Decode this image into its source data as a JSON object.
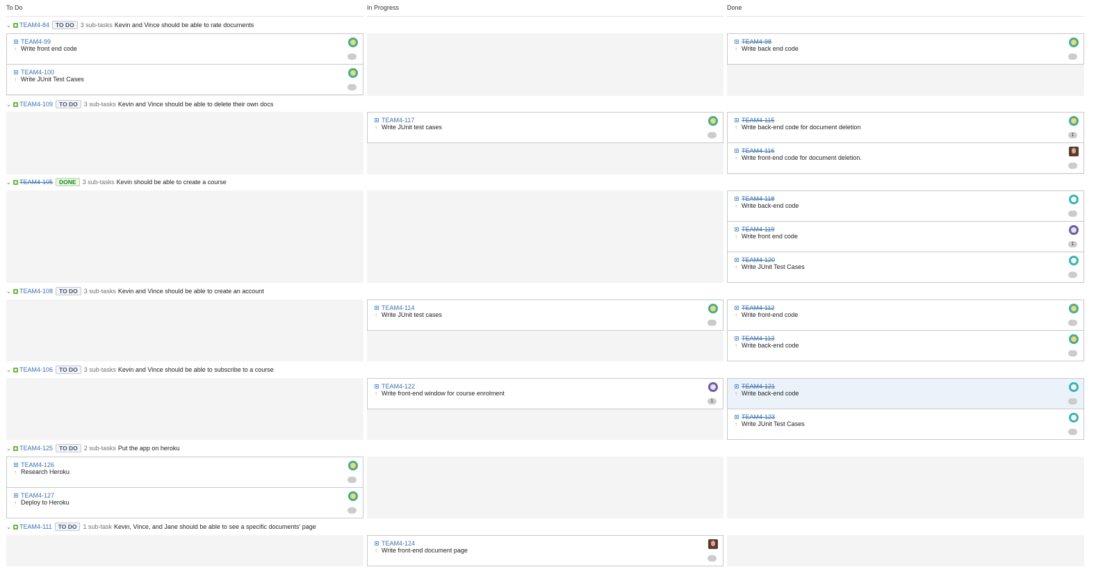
{
  "columns": [
    "To Do",
    "In Progress",
    "Done"
  ],
  "swimlanes": [
    {
      "key": "TEAM4-84",
      "status": "TO DO",
      "subtasks": "3 sub-tasks",
      "summary": "Kevin and Vince should be able to rate documents",
      "todo": [
        {
          "key": "TEAM4-99",
          "summary": "Write front end code",
          "avatar": "green-dog-avatar",
          "estimate": ""
        },
        {
          "key": "TEAM4-100",
          "summary": "Write JUnit Test Cases",
          "avatar": "green-dog-avatar",
          "estimate": ""
        }
      ],
      "inprogress": [],
      "done": [
        {
          "key": "TEAM4-98",
          "summary": "Write back end code",
          "avatar": "green-dog-avatar",
          "estimate": ""
        }
      ]
    },
    {
      "key": "TEAM4-109",
      "status": "TO DO",
      "subtasks": "3 sub-tasks",
      "summary": "Kevin and Vince should be able to delete their own docs",
      "todo": [],
      "inprogress": [
        {
          "key": "TEAM4-117",
          "summary": "Write JUnit test cases",
          "avatar": "teal-cat-avatar",
          "estimate": ""
        }
      ],
      "done": [
        {
          "key": "TEAM4-115",
          "summary": "Write back-end code for document deletion",
          "avatar": "teal-cat-avatar",
          "estimate": "1"
        },
        {
          "key": "TEAM4-116",
          "summary": "Write front-end code for document deletion.",
          "avatar": "photo-avatar",
          "estimate": ""
        }
      ]
    },
    {
      "key": "TEAM4-105",
      "status": "DONE",
      "subtasks": "3 sub-tasks",
      "summary": "Kevin should be able to create a course",
      "todo": [],
      "inprogress": [],
      "done": [
        {
          "key": "TEAM4-118",
          "summary": "Write back-end code",
          "avatar": "teal-robot-avatar",
          "estimate": ""
        },
        {
          "key": "TEAM4-119",
          "summary": "Write front end code",
          "avatar": "purple-monster-avatar",
          "estimate": "1"
        },
        {
          "key": "TEAM4-120",
          "summary": "Write JUnit Test Cases",
          "avatar": "teal-robot-avatar",
          "estimate": ""
        }
      ]
    },
    {
      "key": "TEAM4-108",
      "status": "TO DO",
      "subtasks": "3 sub-tasks",
      "summary": "Kevin and Vince should be able to create an account",
      "todo": [],
      "inprogress": [
        {
          "key": "TEAM4-114",
          "summary": "Write JUnit test cases",
          "avatar": "teal-cat-avatar",
          "estimate": ""
        }
      ],
      "done": [
        {
          "key": "TEAM4-112",
          "summary": "Write front-end code",
          "avatar": "teal-cat-avatar",
          "estimate": ""
        },
        {
          "key": "TEAM4-113",
          "summary": "Write back-end code",
          "avatar": "teal-cat-avatar",
          "estimate": ""
        }
      ]
    },
    {
      "key": "TEAM4-106",
      "status": "TO DO",
      "subtasks": "3 sub-tasks",
      "summary": "Kevin and Vince should be able to subscribe to a course",
      "todo": [],
      "inprogress": [
        {
          "key": "TEAM4-122",
          "summary": "Write front-end window for course enrolment",
          "avatar": "purple-monster-avatar",
          "estimate": "1"
        }
      ],
      "done": [
        {
          "key": "TEAM4-121",
          "summary": "Write back-end code",
          "avatar": "teal-robot-avatar",
          "estimate": "",
          "selected": true
        },
        {
          "key": "TEAM4-123",
          "summary": "Write JUnit Test Cases",
          "avatar": "teal-robot-avatar",
          "estimate": ""
        }
      ]
    },
    {
      "key": "TEAM4-125",
      "status": "TO DO",
      "subtasks": "2 sub-tasks",
      "summary": "Put the app on heroku",
      "todo": [
        {
          "key": "TEAM4-126",
          "summary": "Research Heroku",
          "avatar": "green-dog-avatar",
          "estimate": ""
        },
        {
          "key": "TEAM4-127",
          "summary": "Deploy to Heroku",
          "avatar": "green-dog-avatar",
          "estimate": ""
        }
      ],
      "inprogress": [],
      "done": []
    },
    {
      "key": "TEAM4-111",
      "status": "TO DO",
      "subtasks": "1 sub-task",
      "summary": "Kevin, Vince, and Jane should be able to see a specific documents' page",
      "todo": [],
      "inprogress": [
        {
          "key": "TEAM4-124",
          "summary": "Write front-end document page",
          "avatar": "photo-avatar",
          "estimate": ""
        }
      ],
      "done": []
    }
  ],
  "colors": {
    "link": "#3b73af",
    "story": "#64ba3b",
    "priority": "#f0831f",
    "cell_bg": "#f4f4f4",
    "selected_card": "#ebf2f9"
  },
  "icons": {
    "chevron": "chevron-down-icon",
    "story": "story-icon",
    "subtask": "subtask-icon",
    "priority": "priority-major-icon"
  }
}
